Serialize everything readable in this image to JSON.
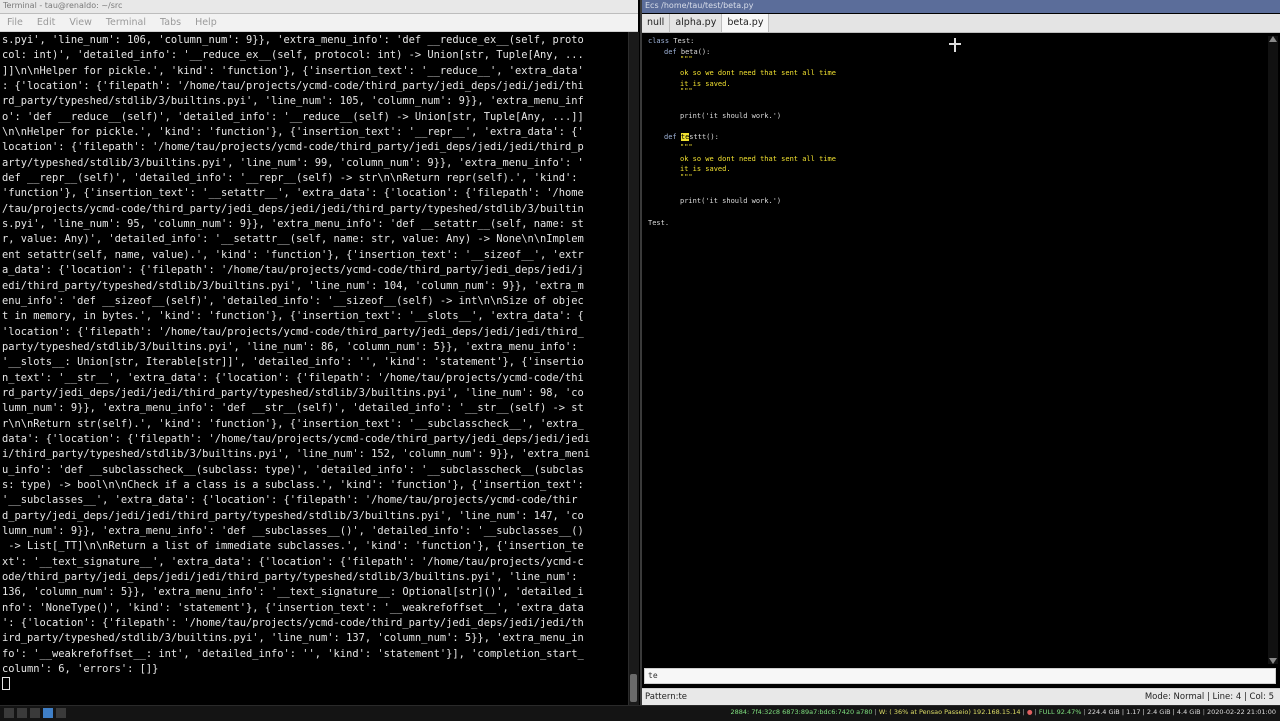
{
  "terminal": {
    "title": "Terminal - tau@renaldo: ~/src",
    "menu": [
      "File",
      "Edit",
      "View",
      "Terminal",
      "Tabs",
      "Help"
    ],
    "lines": [
      "s.pyi', 'line_num': 106, 'column_num': 9}}, 'extra_menu_info': 'def __reduce_ex__(self, proto",
      "col: int)', 'detailed_info': '__reduce_ex__(self, protocol: int) -> Union[str, Tuple[Any, ...",
      "]]\\n\\nHelper for pickle.', 'kind': 'function'}, {'insertion_text': '__reduce__', 'extra_data'",
      ": {'location': {'filepath': '/home/tau/projects/ycmd-code/third_party/jedi_deps/jedi/jedi/thi",
      "rd_party/typeshed/stdlib/3/builtins.pyi', 'line_num': 105, 'column_num': 9}}, 'extra_menu_inf",
      "o': 'def __reduce__(self)', 'detailed_info': '__reduce__(self) -> Union[str, Tuple[Any, ...]]",
      "\\n\\nHelper for pickle.', 'kind': 'function'}, {'insertion_text': '__repr__', 'extra_data': {'",
      "location': {'filepath': '/home/tau/projects/ycmd-code/third_party/jedi_deps/jedi/jedi/third_p",
      "arty/typeshed/stdlib/3/builtins.pyi', 'line_num': 99, 'column_num': 9}}, 'extra_menu_info': '",
      "def __repr__(self)', 'detailed_info': '__repr__(self) -> str\\n\\nReturn repr(self).', 'kind':",
      "'function'}, {'insertion_text': '__setattr__', 'extra_data': {'location': {'filepath': '/home",
      "/tau/projects/ycmd-code/third_party/jedi_deps/jedi/jedi/third_party/typeshed/stdlib/3/builtin",
      "s.pyi', 'line_num': 95, 'column_num': 9}}, 'extra_menu_info': 'def __setattr__(self, name: st",
      "r, value: Any)', 'detailed_info': '__setattr__(self, name: str, value: Any) -> None\\n\\nImplem",
      "ent setattr(self, name, value).', 'kind': 'function'}, {'insertion_text': '__sizeof__', 'extr",
      "a_data': {'location': {'filepath': '/home/tau/projects/ycmd-code/third_party/jedi_deps/jedi/j",
      "edi/third_party/typeshed/stdlib/3/builtins.pyi', 'line_num': 104, 'column_num': 9}}, 'extra_m",
      "enu_info': 'def __sizeof__(self)', 'detailed_info': '__sizeof__(self) -> int\\n\\nSize of objec",
      "t in memory, in bytes.', 'kind': 'function'}, {'insertion_text': '__slots__', 'extra_data': {",
      "'location': {'filepath': '/home/tau/projects/ycmd-code/third_party/jedi_deps/jedi/jedi/third_",
      "party/typeshed/stdlib/3/builtins.pyi', 'line_num': 86, 'column_num': 5}}, 'extra_menu_info':",
      "'__slots__: Union[str, Iterable[str]]', 'detailed_info': '', 'kind': 'statement'}, {'insertio",
      "n_text': '__str__', 'extra_data': {'location': {'filepath': '/home/tau/projects/ycmd-code/thi",
      "rd_party/jedi_deps/jedi/jedi/third_party/typeshed/stdlib/3/builtins.pyi', 'line_num': 98, 'co",
      "lumn_num': 9}}, 'extra_menu_info': 'def __str__(self)', 'detailed_info': '__str__(self) -> st",
      "r\\n\\nReturn str(self).', 'kind': 'function'}, {'insertion_text': '__subclasscheck__', 'extra_",
      "data': {'location': {'filepath': '/home/tau/projects/ycmd-code/third_party/jedi_deps/jedi/jedi",
      "i/third_party/typeshed/stdlib/3/builtins.pyi', 'line_num': 152, 'column_num': 9}}, 'extra_meni",
      "u_info': 'def __subclasscheck__(subclass: type)', 'detailed_info': '__subclasscheck__(subclas",
      "s: type) -> bool\\n\\nCheck if a class is a subclass.', 'kind': 'function'}, {'insertion_text':",
      "'__subclasses__', 'extra_data': {'location': {'filepath': '/home/tau/projects/ycmd-code/thir",
      "d_party/jedi_deps/jedi/jedi/third_party/typeshed/stdlib/3/builtins.pyi', 'line_num': 147, 'co",
      "lumn_num': 9}}, 'extra_menu_info': 'def __subclasses__()', 'detailed_info': '__subclasses__()",
      " -> List[_TT]\\n\\nReturn a list of immediate subclasses.', 'kind': 'function'}, {'insertion_te",
      "xt': '__text_signature__', 'extra_data': {'location': {'filepath': '/home/tau/projects/ycmd-c",
      "ode/third_party/jedi_deps/jedi/jedi/third_party/typeshed/stdlib/3/builtins.pyi', 'line_num':",
      "136, 'column_num': 5}}, 'extra_menu_info': '__text_signature__: Optional[str]()', 'detailed_i",
      "nfo': 'NoneType()', 'kind': 'statement'}, {'insertion_text': '__weakrefoffset__', 'extra_data",
      "': {'location': {'filepath': '/home/tau/projects/ycmd-code/third_party/jedi_deps/jedi/jedi/th",
      "ird_party/typeshed/stdlib/3/builtins.pyi', 'line_num': 137, 'column_num': 5}}, 'extra_menu_in",
      "fo': '__weakrefoffset__: int', 'detailed_info': '', 'kind': 'statement'}], 'completion_start_",
      "column': 6, 'errors': []}"
    ]
  },
  "editor": {
    "title": "Ecs /home/tau/test/beta.py",
    "tabs": [
      "null",
      "alpha.py",
      "beta.py"
    ],
    "active_tab": 2,
    "code": [
      {
        "indent": 0,
        "kw": "class ",
        "rest": "Test:"
      },
      {
        "indent": 16,
        "kw": "def ",
        "rest": "beta():"
      },
      {
        "indent": 32,
        "doc": "\"\"\""
      },
      {
        "indent": 32,
        "doc": "ok so we dont need that sent all time"
      },
      {
        "indent": 32,
        "doc": "it is saved."
      },
      {
        "indent": 32,
        "doc": "\"\"\""
      },
      {
        "indent": 0,
        "plain": ""
      },
      {
        "indent": 32,
        "plain": "print('it should work.')"
      },
      {
        "indent": 0,
        "plain": ""
      },
      {
        "indent": 16,
        "kw": "def ",
        "hl": "te",
        "rest": "sttt():"
      },
      {
        "indent": 32,
        "doc": "\"\"\""
      },
      {
        "indent": 32,
        "doc": "ok so we dont need that sent all time"
      },
      {
        "indent": 32,
        "doc": "it is saved."
      },
      {
        "indent": 32,
        "doc": "\"\"\""
      },
      {
        "indent": 0,
        "plain": ""
      },
      {
        "indent": 32,
        "plain": "print('it should work.')"
      },
      {
        "indent": 0,
        "plain": ""
      },
      {
        "indent": 0,
        "plain": "Test."
      }
    ],
    "input_value": "te",
    "status_left": "Pattern:te",
    "status_right": "Mode: Normal | Line: 4 | Col: 5"
  },
  "taskbar": {
    "tray_left": "2884: 7f4:32c8 6873:89a7:bdc6:7420 a780",
    "tray_wifi": "W: ( 36% at Pensao Passeio) 192.168.15.14",
    "tray_bat": "FULL 92.47%",
    "tray_mem": "224.4 GiB | 1.17 | 2.4 GiB | 4.4 GiB",
    "tray_time": "2020-02-22 21:01:00"
  },
  "colors": {
    "doc": "#f0e030",
    "keyword": "#9fb3d8",
    "editor_title": "#5b6d9a",
    "workspace_active": "#3f7fc7"
  }
}
